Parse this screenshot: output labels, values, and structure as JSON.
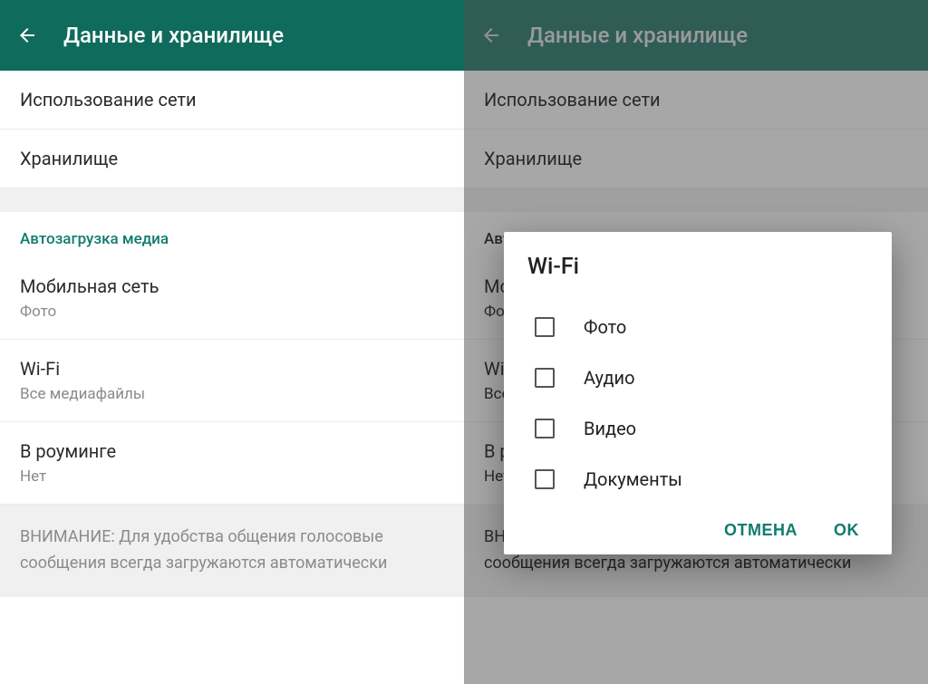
{
  "header": {
    "title": "Данные и хранилище"
  },
  "rows": {
    "network_usage": "Использование сети",
    "storage": "Хранилище"
  },
  "section_autoload": "Автозагрузка медиа",
  "autoload": {
    "mobile": {
      "title": "Мобильная сеть",
      "sub": "Фото"
    },
    "wifi": {
      "title": "Wi-Fi",
      "sub": "Все медиафайлы"
    },
    "roaming": {
      "title": "В роуминге",
      "sub": "Нет"
    }
  },
  "note": "ВНИМАНИЕ: Для удобства общения голосовые сообщения всегда загружаются автоматически",
  "dialog": {
    "title": "Wi-Fi",
    "options": {
      "photo": "Фото",
      "audio": "Аудио",
      "video": "Видео",
      "docs": "Документы"
    },
    "cancel": "ОТМЕНА",
    "ok": "OK"
  },
  "right_partial": {
    "m": "М",
    "f": "Ф",
    "w": "W",
    "b": "В",
    "b2": "В",
    "n": "Н",
    "bn": "ВН"
  }
}
